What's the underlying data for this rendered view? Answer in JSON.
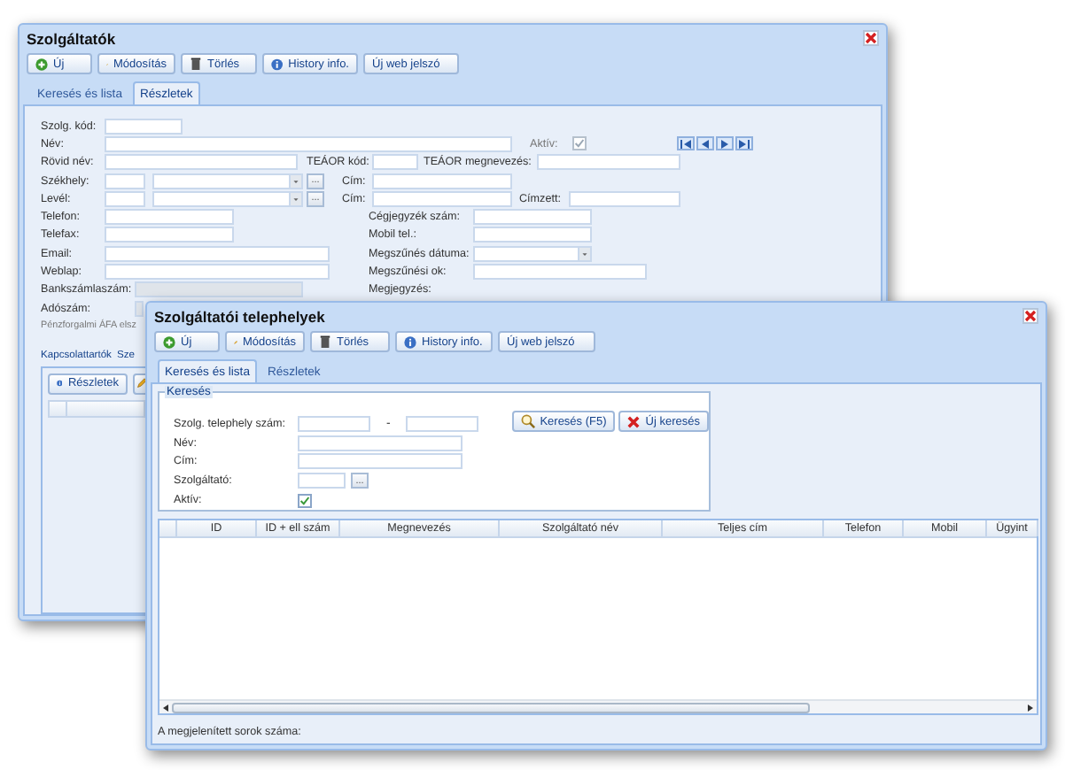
{
  "back_window": {
    "title": "Szolgáltatók",
    "toolbar": [
      {
        "label": "Új",
        "kind": "add"
      },
      {
        "label": "Módosítás",
        "kind": "edit"
      },
      {
        "label": "Törlés",
        "kind": "delete"
      },
      {
        "label": "History info.",
        "kind": "info"
      },
      {
        "label": "Új web jelszó",
        "kind": "plain"
      }
    ],
    "tabs": [
      {
        "label": "Keresés és lista",
        "selected": false
      },
      {
        "label": "Részletek",
        "selected": true
      }
    ],
    "fields": [
      {
        "label": "Szolg. kód:"
      },
      {
        "label": "Név:"
      },
      {
        "label": "Rövid név:"
      },
      {
        "label": "TEÁOR kód:"
      },
      {
        "label": "TEÁOR megnevezés:"
      },
      {
        "label": "Székhely:",
        "picker": "..."
      },
      {
        "label": "Cím:"
      },
      {
        "label": "Levél:",
        "picker": "..."
      },
      {
        "label": "Cím:"
      },
      {
        "label": "Címzett:"
      },
      {
        "label": "Telefon:"
      },
      {
        "label": "Cégjegyzék szám:"
      },
      {
        "label": "Telefax:"
      },
      {
        "label": "Mobil tel.:"
      },
      {
        "label": "Email:"
      },
      {
        "label": "Megszűnés dátuma:"
      },
      {
        "label": "Weblap:"
      },
      {
        "label": "Megszűnési ok:"
      },
      {
        "label": "Bankszámlaszám:"
      },
      {
        "label": "Megjegyzés:"
      },
      {
        "label": "Adószám:"
      },
      {
        "label": "Pénzforgalmi ÁFA elsz"
      }
    ],
    "active": {
      "label": "Aktív:",
      "checked": true
    },
    "sub_tabs": [
      {
        "label": "Kapcsolattartók"
      },
      {
        "label": "Sze"
      }
    ],
    "sub_toolbar": [
      {
        "label": "Részletek",
        "kind": "info"
      },
      {
        "kind": "edit"
      }
    ]
  },
  "front_window": {
    "title": "Szolgáltatói telephelyek",
    "toolbar": [
      {
        "label": "Új",
        "kind": "add"
      },
      {
        "label": "Módosítás",
        "kind": "edit"
      },
      {
        "label": "Törlés",
        "kind": "delete"
      },
      {
        "label": "History info.",
        "kind": "info"
      },
      {
        "label": "Új web jelszó",
        "kind": "plain"
      }
    ],
    "tabs": [
      {
        "label": "Keresés és lista",
        "selected": true
      },
      {
        "label": "Részletek",
        "selected": false
      }
    ],
    "search": {
      "legend": "Keresés",
      "number_label": "Szolg. telephely szám:",
      "range_dash": "-",
      "name_label": "Név:",
      "address_label": "Cím:",
      "provider_label": "Szolgáltató:",
      "provider_picker": "...",
      "active": {
        "label": "Aktív:",
        "checked": true
      },
      "buttons": [
        {
          "label": "Keresés (F5)",
          "kind": "search"
        },
        {
          "label": "Új keresés",
          "kind": "clear"
        }
      ]
    },
    "table": {
      "columns": [
        "ID",
        "ID + ell szám",
        "Megnevezés",
        "Szolgáltató név",
        "Teljes cím",
        "Telefon",
        "Mobil",
        "Ügyint"
      ]
    },
    "footer": "A megjelenített sorok száma:"
  }
}
